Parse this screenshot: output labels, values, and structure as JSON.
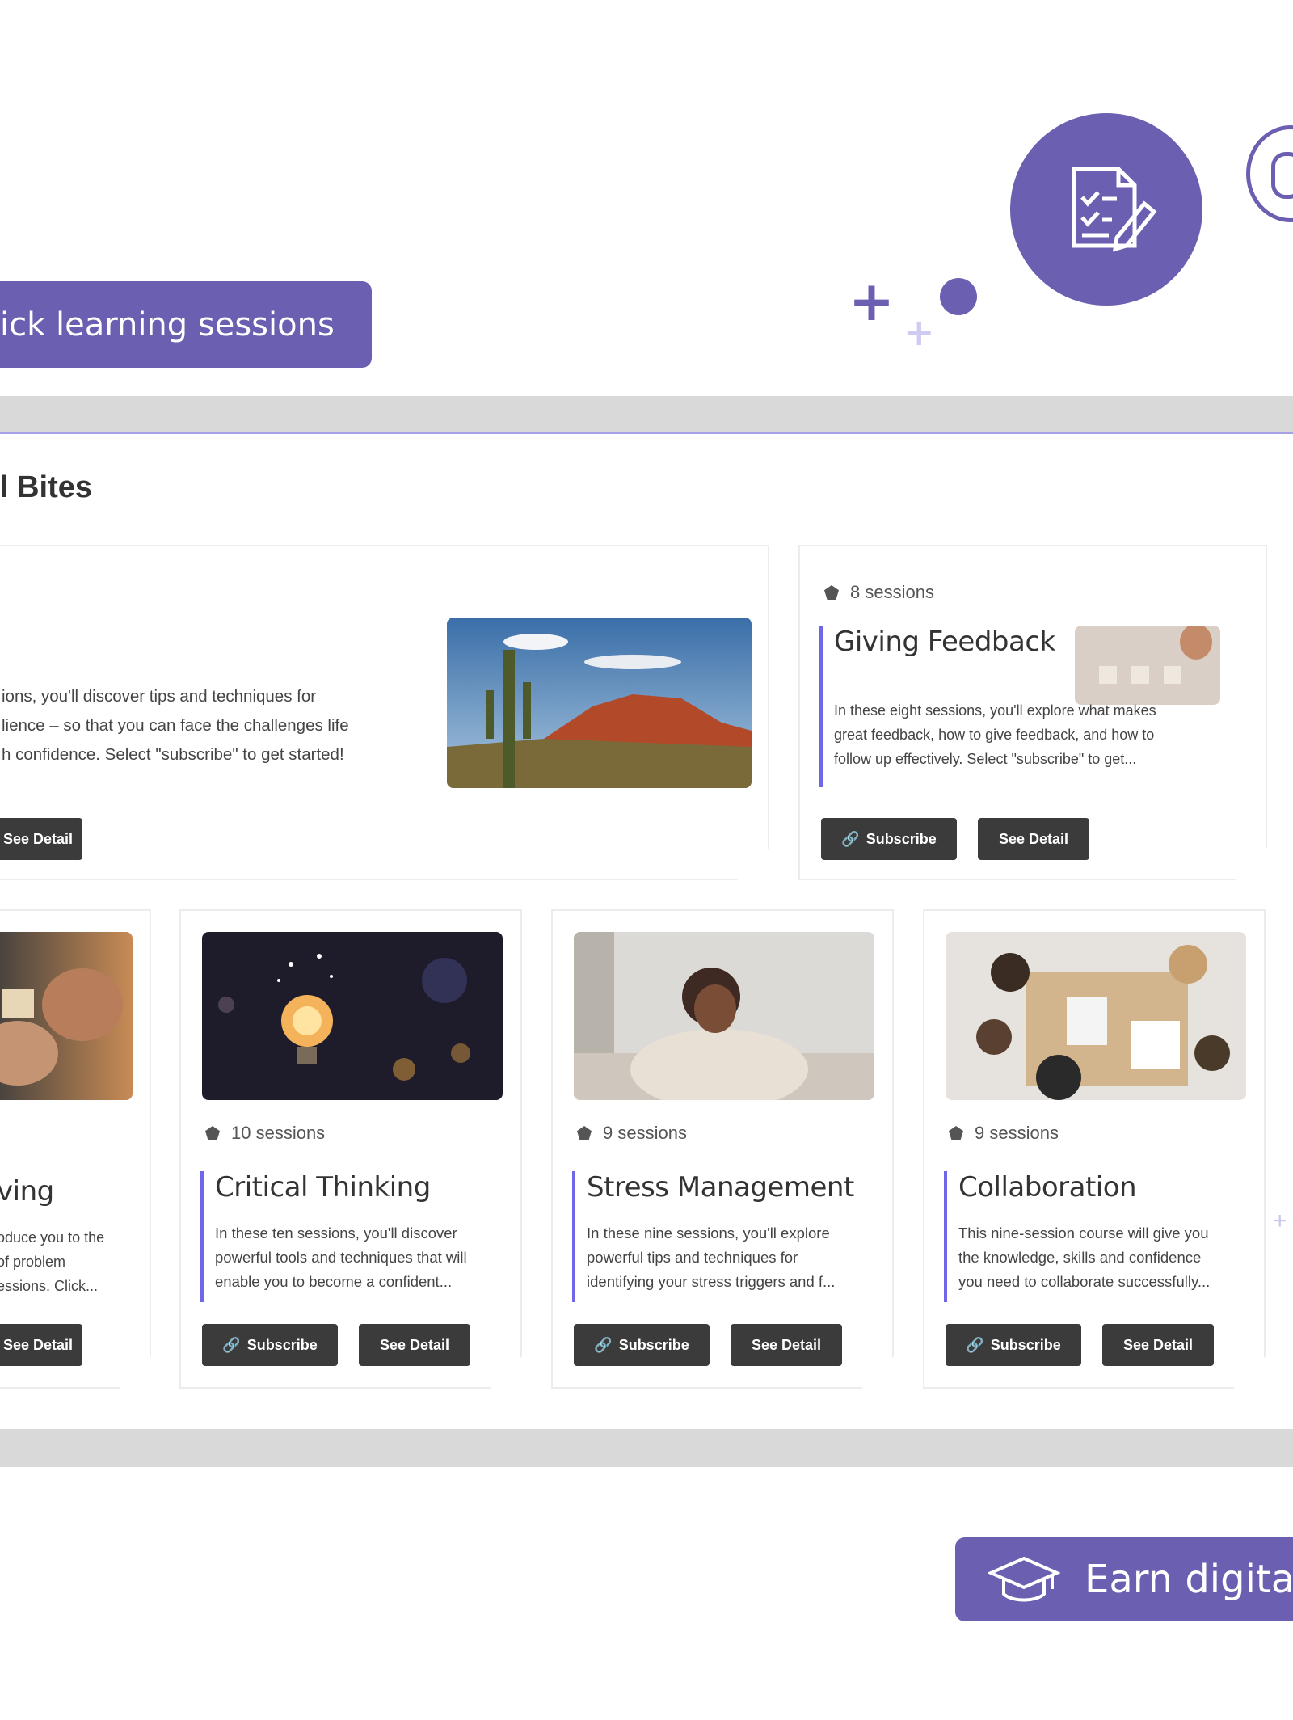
{
  "header": {
    "sessions_pill_text": "ick learning sessions",
    "icons": [
      "document-edit-icon",
      "stopwatch-icon",
      "plus-icon",
      "dot-icon"
    ]
  },
  "section": {
    "title": "l Bites"
  },
  "featured_card": {
    "desc_lines": [
      "ions, you'll discover tips and techniques for",
      "lience – so that you can face the challenges life",
      "h confidence. Select \"subscribe\" to get started!"
    ],
    "detail_label": "See Detail",
    "image": "desert-cactus-image"
  },
  "feedback_card": {
    "sessions": "8 sessions",
    "title": "Giving Feedback",
    "desc_lines": [
      "In these eight sessions, you'll explore what makes",
      "great feedback, how to give feedback, and how to",
      "follow up effectively. Select \"subscribe\" to get..."
    ],
    "subscribe_label": "Subscribe",
    "detail_label": "See Detail",
    "image": "feedback-blocks-image"
  },
  "problem_card": {
    "title": "ving",
    "desc_lines": [
      "oduce you to the",
      "of problem",
      "essions. Click..."
    ],
    "detail_label": "See Detail",
    "image": "puzzle-hands-image"
  },
  "cards": [
    {
      "sessions": "10 sessions",
      "title": "Critical Thinking",
      "desc_lines": [
        "In these ten sessions, you'll discover",
        "powerful tools and techniques that will",
        "enable you to become a confident..."
      ],
      "subscribe_label": "Subscribe",
      "detail_label": "See Detail",
      "image": "lightbulb-image"
    },
    {
      "sessions": "9 sessions",
      "title": "Stress Management",
      "desc_lines": [
        "In these nine sessions, you'll explore",
        "powerful tips and techniques for",
        "identifying your stress triggers and f..."
      ],
      "subscribe_label": "Subscribe",
      "detail_label": "See Detail",
      "image": "relaxing-woman-image"
    },
    {
      "sessions": "9 sessions",
      "title": "Collaboration",
      "desc_lines": [
        "This nine-session course will give you",
        "the knowledge, skills and confidence",
        "you need to collaborate successfully..."
      ],
      "subscribe_label": "Subscribe",
      "detail_label": "See Detail",
      "image": "team-table-image"
    }
  ],
  "footer": {
    "badge_pill_text": "Earn digita",
    "icon": "graduation-cap-icon"
  },
  "colors": {
    "accent": "#6a5fb0",
    "accent_line": "#6f66e8",
    "button": "#3b3b3b",
    "panel_bar": "#d9d9d9"
  }
}
